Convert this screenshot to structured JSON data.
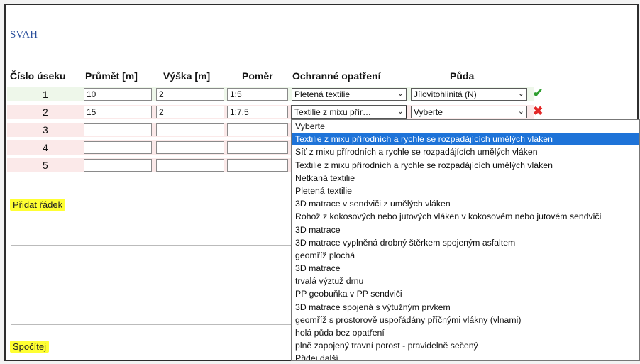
{
  "title": "SVAH",
  "headers": {
    "cislo": "Číslo úseku",
    "prumer": "Průmět [m]",
    "vyska": "Výška [m]",
    "pomer": "Poměr",
    "ochranne": "Ochranné opatření",
    "puda": "Půda"
  },
  "rows": [
    {
      "num": "1",
      "prumer": "10",
      "vyska": "2",
      "pomer": "1:5",
      "ochranne": "Pletená textilie",
      "puda": "Jílovitohlinitá (N)",
      "status": "✔"
    },
    {
      "num": "2",
      "prumer": "15",
      "vyska": "2",
      "pomer": "1:7.5",
      "ochranne": "Textilie z mixu přír…",
      "puda": "Vyberte",
      "status": "✖"
    },
    {
      "num": "3",
      "prumer": "",
      "vyska": "",
      "pomer": ""
    },
    {
      "num": "4",
      "prumer": "",
      "vyska": "",
      "pomer": ""
    },
    {
      "num": "5",
      "prumer": "",
      "vyska": "",
      "pomer": ""
    }
  ],
  "caret": "⌄",
  "buttons": {
    "add_row": "Přidat řádek",
    "compute": "Spočítej"
  },
  "dropdown": {
    "selected_index": 1,
    "options": [
      "Vyberte",
      "Textilie z mixu přírodních a rychle se rozpadájících umělých vláken",
      "Síť z mixu přírodních a rychle se rozpadájících umělých vláken",
      "Textilie z mixu přírodních a rychle se rozpadájících umělých vláken",
      "Netkaná textilie",
      "Pletená textilie",
      "3D matrace v sendviči z umělých vláken",
      "Rohož z kokosových nebo jutových vláken v kokosovém nebo jutovém sendviči",
      "3D matrace",
      "3D matrace vyplněná drobný štěrkem spojeným asfaltem",
      "geomříž plochá",
      "3D matrace",
      "trvalá výztuž drnu",
      "PP geobuňka v PP sendviči",
      "3D matrace spojená s výtužným prvkem",
      "geomříž s prostorově uspořádány příčnými vlákny (vlnami)",
      "holá půda bez opatření",
      "plně zapojený travní porost - pravidelně sečený",
      "Přidej další"
    ]
  },
  "colors": {
    "title": "#2a4f9c",
    "button_bg": "#ffff33",
    "selected_option": "#1e73d8",
    "ok": "#2e9e2e",
    "error": "#e32626"
  }
}
